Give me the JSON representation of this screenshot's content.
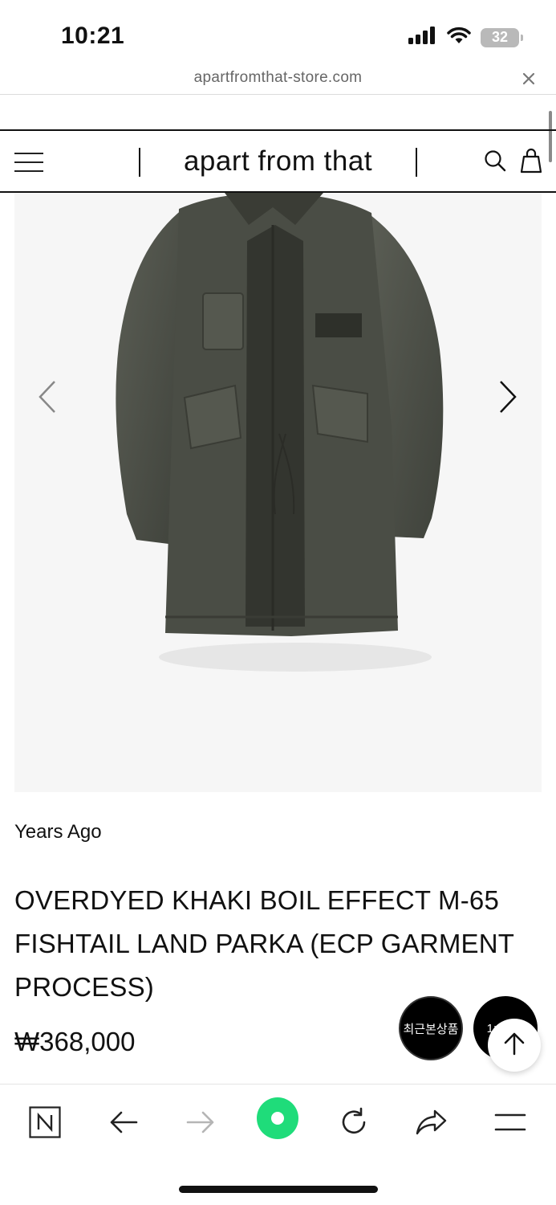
{
  "status_bar": {
    "time": "10:21",
    "battery": "32",
    "icons": [
      "signal-icon",
      "wifi-icon",
      "battery-icon"
    ]
  },
  "browser": {
    "url": "apartfromthat-store.com",
    "close_icon": "close-icon"
  },
  "header": {
    "brand": "apart from that",
    "icons": [
      "menu-icon",
      "search-icon",
      "bag-icon"
    ]
  },
  "product": {
    "image_alt_icon": "parka-jacket-image",
    "brand_label": "Years Ago",
    "title": "OVERDYED KHAKI BOIL EFFECT M-65 FISHTAIL LAND PARKA (ECP GARMENT PROCESS)",
    "price": "₩368,000",
    "carousel_icons": [
      "chevron-left-icon",
      "chevron-right-icon"
    ]
  },
  "floating": {
    "recent_label": "최근본상품",
    "chat_label": "1:1",
    "top_icon": "arrow-up-icon"
  },
  "toolbar": {
    "items": [
      "naver-icon",
      "back-icon",
      "forward-icon",
      "green-dot-icon",
      "reload-icon",
      "share-icon",
      "menu-icon"
    ]
  },
  "colors": {
    "green": "#1fdc7a",
    "text": "#111111",
    "image_bg": "#f6f6f6"
  }
}
